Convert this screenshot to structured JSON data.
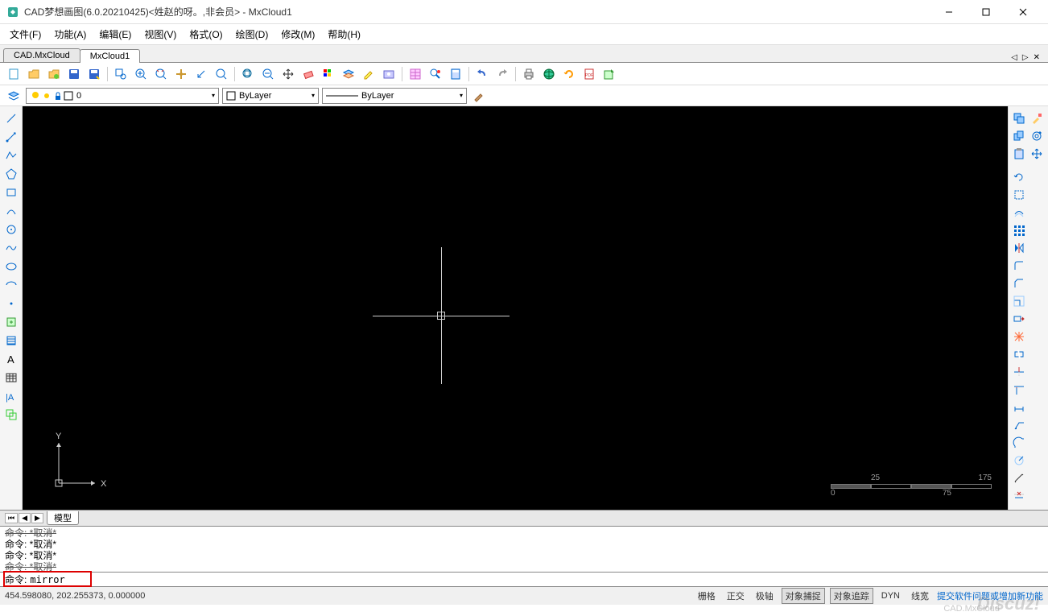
{
  "title": "CAD梦想画图(6.0.20210425)<姓赵的呀。,非会员> - MxCloud1",
  "menus": [
    "文件(F)",
    "功能(A)",
    "编辑(E)",
    "视图(V)",
    "格式(O)",
    "绘图(D)",
    "修改(M)",
    "帮助(H)"
  ],
  "tabs": [
    {
      "label": "CAD.MxCloud",
      "active": false
    },
    {
      "label": "MxCloud1",
      "active": true
    }
  ],
  "layer": {
    "current": "0",
    "linetype": "ByLayer",
    "color": "ByLayer"
  },
  "modeltab": "模型",
  "cmdhistory": [
    {
      "text": "命令: *取消*",
      "strike": true
    },
    {
      "text": "命令: *取消*",
      "strike": false
    },
    {
      "text": "命令: *取消*",
      "strike": false
    },
    {
      "text": "命令: *取消*",
      "strike": true
    }
  ],
  "cmdprompt": "命令:",
  "cmdinput": "mirror",
  "coords": "454.598080, 202.255373, 0.000000",
  "statusbtns": [
    {
      "label": "栅格",
      "boxed": false
    },
    {
      "label": "正交",
      "boxed": false
    },
    {
      "label": "极轴",
      "boxed": false
    },
    {
      "label": "对象捕捉",
      "boxed": true
    },
    {
      "label": "对象追踪",
      "boxed": true
    },
    {
      "label": "DYN",
      "boxed": false
    },
    {
      "label": "线宽",
      "boxed": false
    }
  ],
  "statuslink": "提交软件问题或增加新功能",
  "scale": {
    "min": "0",
    "q1": "25",
    "q2": "75",
    "max": "175"
  },
  "ucs": {
    "x": "X",
    "y": "Y"
  },
  "watermark": "Discuz!",
  "overlay": "CAD.MxCloud"
}
